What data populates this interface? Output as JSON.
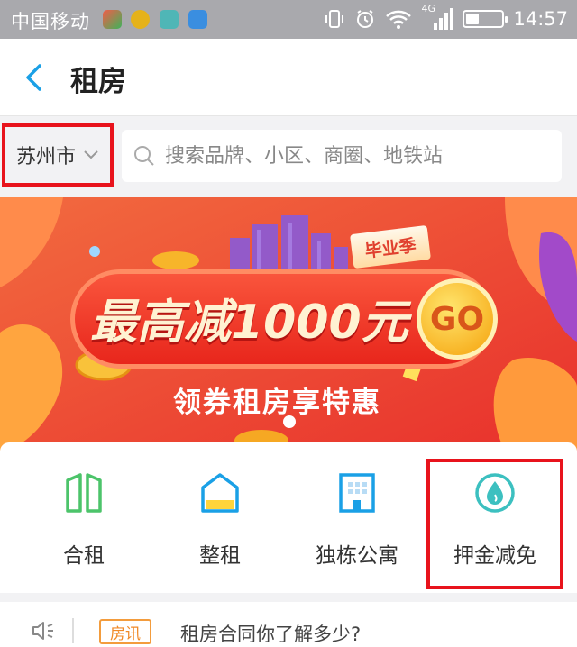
{
  "status_bar": {
    "carrier": "中国移动",
    "network": "4G",
    "time": "14:57"
  },
  "header": {
    "title": "租房"
  },
  "search": {
    "city": "苏州市",
    "placeholder": "搜索品牌、小区、商圈、地铁站"
  },
  "banner": {
    "tag": "毕业季",
    "headline": "最高减1000元",
    "go_label": "GO",
    "subtitle": "领券租房享特惠"
  },
  "quick_menu": {
    "items": [
      {
        "label": "合租",
        "icon": "shared-rent-icon"
      },
      {
        "label": "整租",
        "icon": "whole-rent-icon"
      },
      {
        "label": "独栋公寓",
        "icon": "apartment-building-icon"
      },
      {
        "label": "押金减免",
        "icon": "deposit-waiver-icon"
      }
    ]
  },
  "news": {
    "badge": "房讯",
    "text": "租房合同你了解多少?"
  },
  "colors": {
    "accent_blue": "#1aa0e6",
    "highlight_red": "#e8131c",
    "banner_red": "#ef4b3c",
    "teal": "#3cc0c0",
    "green": "#4cc46a",
    "badge_orange": "#f08a28"
  }
}
